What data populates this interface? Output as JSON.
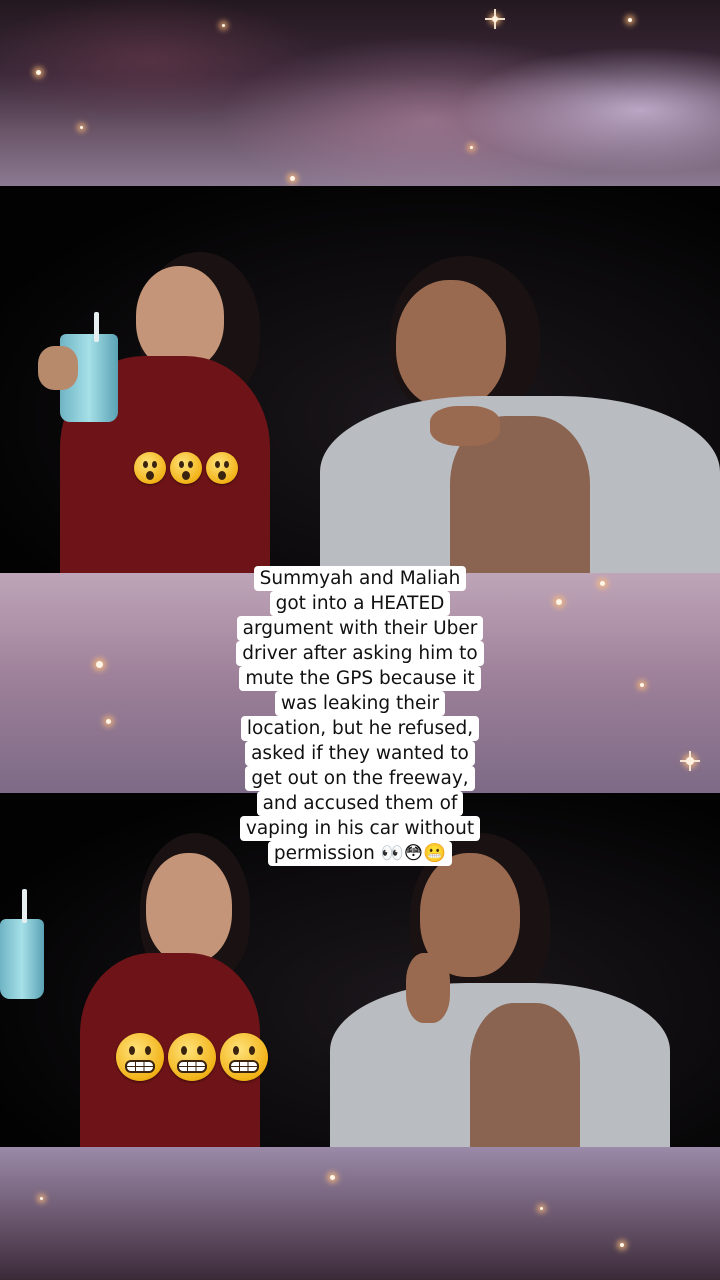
{
  "caption": {
    "lines": [
      "Summyah and Maliah",
      "got into a HEATED",
      "argument with their Uber",
      "driver after asking him to",
      "mute the GPS because it",
      "was leaking their",
      "location, but he refused,",
      "asked if they wanted to",
      "get out on the freeway,",
      "and accused them of",
      "vaping in his car without",
      "permission 👀😳😬"
    ]
  },
  "top_video": {
    "overlay_emojis": [
      "astonished-face",
      "astonished-face",
      "astonished-face"
    ]
  },
  "bottom_video": {
    "overlay_emojis": [
      "grimacing-face",
      "grimacing-face",
      "grimacing-face"
    ]
  },
  "colors": {
    "caption_bg": "#ffffff",
    "caption_text": "#111111",
    "emoji_yellow": "#f2b318"
  }
}
